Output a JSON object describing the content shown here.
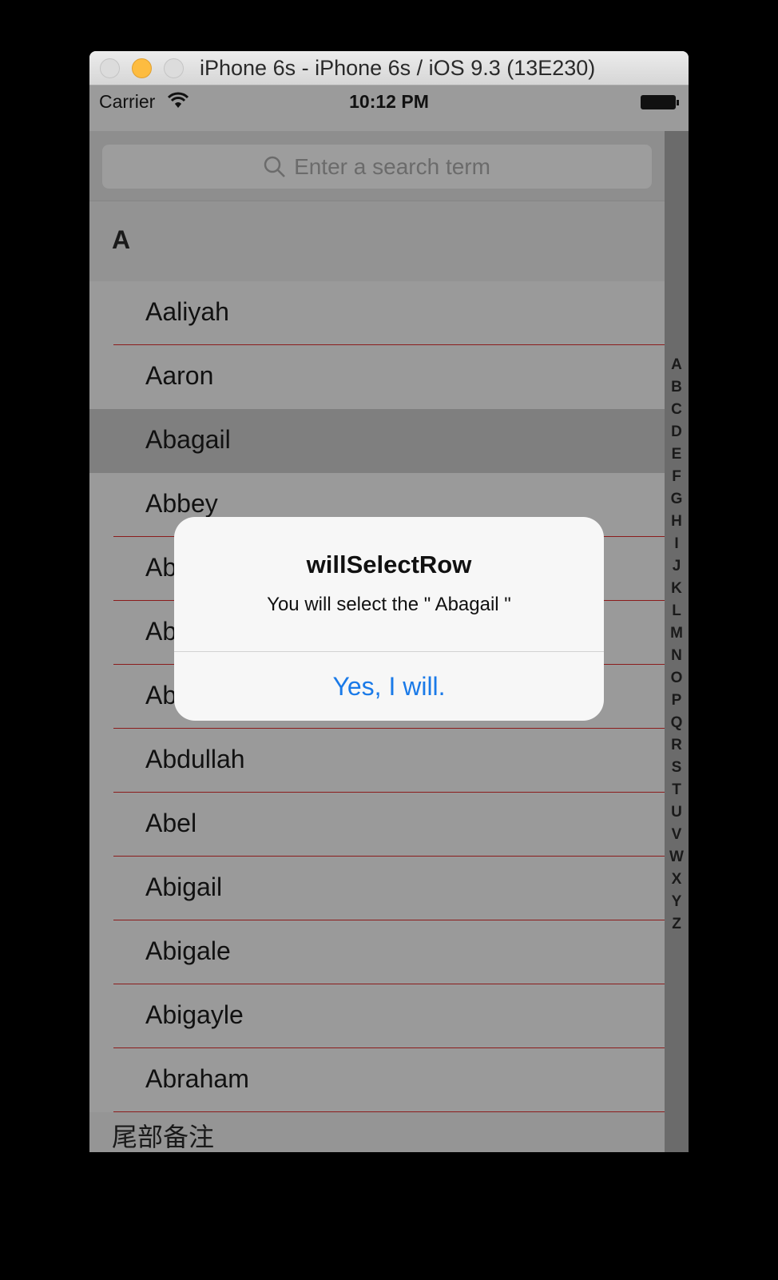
{
  "window": {
    "title": "iPhone 6s - iPhone 6s / iOS 9.3 (13E230)",
    "lights": {
      "close": "#dcdcdc",
      "minimize": "#fdbc40",
      "zoom": "#dcdcdc"
    }
  },
  "status": {
    "carrier": "Carrier",
    "time": "10:12 PM"
  },
  "search": {
    "placeholder": "Enter a search term"
  },
  "section": "A",
  "rows": [
    "Aaliyah",
    "Aaron",
    "Abagail",
    "Abbey",
    "Ab",
    "Ab",
    "Ab",
    "Abdullah",
    "Abel",
    "Abigail",
    "Abigale",
    "Abigayle",
    "Abraham"
  ],
  "selected_row": "Abagail",
  "footer": "尾部备注",
  "index": [
    "A",
    "B",
    "C",
    "D",
    "E",
    "F",
    "G",
    "H",
    "I",
    "J",
    "K",
    "L",
    "M",
    "N",
    "O",
    "P",
    "Q",
    "R",
    "S",
    "T",
    "U",
    "V",
    "W",
    "X",
    "Y",
    "Z"
  ],
  "alert": {
    "title": "willSelectRow",
    "message": "You will select the \" Abagail \"",
    "button": "Yes, I will."
  },
  "colors": {
    "separator": "#8b1c1c",
    "accent": "#1a7ae8"
  }
}
